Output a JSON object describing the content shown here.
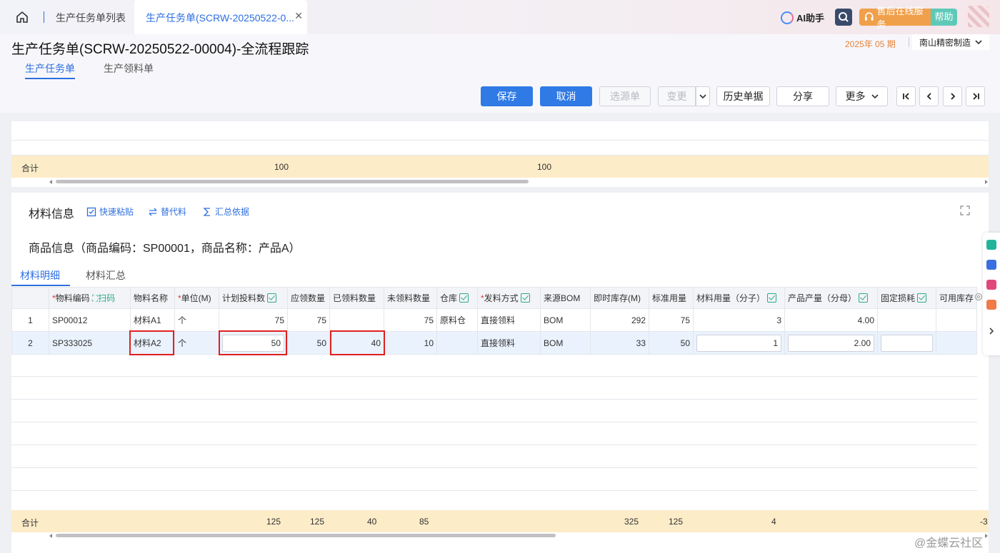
{
  "topbar": {
    "tab_list": "生产任务单列表",
    "tab_active": "生产任务单(SCRW-20250522-0...",
    "ai_label": "AI助手",
    "service_label": "售后在线服务",
    "help_label": "帮助"
  },
  "header": {
    "title": "生产任务单(SCRW-20250522-00004)-全流程跟踪",
    "period": "2025年 05 期",
    "org": "南山精密制造",
    "tabs": [
      "生产任务单",
      "生产领料单"
    ]
  },
  "toolbar": {
    "save": "保存",
    "cancel": "取消",
    "select_source": "选源单",
    "change": "变更",
    "history": "历史单据",
    "share": "分享",
    "more": "更多"
  },
  "upper_summary": {
    "label": "合计",
    "v1": "100",
    "v2": "100"
  },
  "material": {
    "section_title": "材料信息",
    "quick_paste": "快速粘贴",
    "substitute": "替代料",
    "summary_basis": "汇总依据",
    "goods_info": "商品信息（商品编码：SP00001，商品名称：产品A）",
    "tabs": [
      "材料明细",
      "材料汇总"
    ],
    "columns": [
      "物料编码",
      "扫码",
      "物料名称",
      "单位(M)",
      "计划投料数",
      "应领数量",
      "已领料数量",
      "未领料数量",
      "仓库",
      "发料方式",
      "来源BOM",
      "即时库存(M)",
      "标准用量",
      "材料用量（分子）",
      "产品产量（分母）",
      "固定损耗",
      "可用库存"
    ],
    "rows": [
      {
        "idx": "1",
        "code": "SP00012",
        "name": "材料A1",
        "unit": "个",
        "plan": "75",
        "should": "75",
        "received": "",
        "unreceived": "75",
        "warehouse": "原料仓",
        "method": "直接领料",
        "bom": "BOM",
        "stock": "292",
        "std": "75",
        "numerator": "3",
        "denominator": "4.00",
        "loss": "",
        "avail": ""
      },
      {
        "idx": "2",
        "code": "SP333025",
        "name": "材料A2",
        "unit": "个",
        "plan": "50",
        "should": "50",
        "received": "40",
        "unreceived": "10",
        "warehouse": "",
        "method": "直接领料",
        "bom": "BOM",
        "stock": "33",
        "std": "50",
        "numerator": "1",
        "denominator": "2.00",
        "loss": "",
        "avail": ""
      }
    ],
    "total": {
      "label": "合计",
      "plan": "125",
      "should": "125",
      "received": "40",
      "unreceived": "85",
      "stock": "325",
      "std": "125",
      "numerator": "4",
      "tail": "-3"
    }
  },
  "watermark": "@金蝶云社区",
  "colors": {
    "primary": "#2f7ae5",
    "sum_bg": "#fcecc8",
    "highlight": "#e02020",
    "period": "#e6823a"
  }
}
